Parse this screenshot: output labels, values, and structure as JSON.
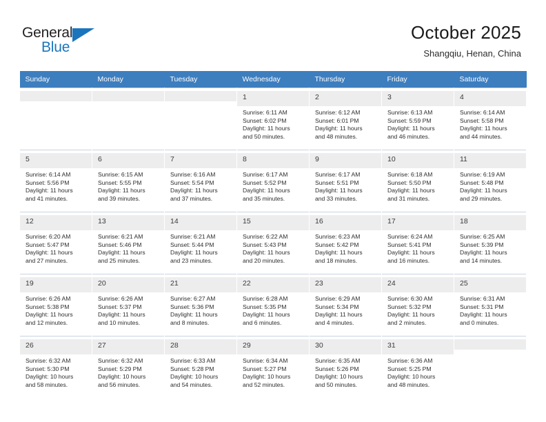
{
  "logo": {
    "word_top": "General",
    "word_bottom": "Blue",
    "triangle_color": "#1b75bc",
    "triangle_icon": "triangle-icon"
  },
  "header": {
    "title": "October 2025",
    "subtitle": "Shangqiu, Henan, China"
  },
  "theme": {
    "header_bg": "#3d7ebf",
    "header_text": "#ffffff",
    "daynum_shade": "#ededed",
    "grid_line": "#c8d4e0",
    "brand_blue": "#1b75bc"
  },
  "weekday_headers": [
    "Sunday",
    "Monday",
    "Tuesday",
    "Wednesday",
    "Thursday",
    "Friday",
    "Saturday"
  ],
  "labels": {
    "sunrise": "Sunrise:",
    "sunset": "Sunset:",
    "daylight": "Daylight:"
  },
  "weeks": [
    [
      {
        "day": "",
        "empty": true,
        "shaded": true,
        "line1": "",
        "line2": "",
        "line3": "",
        "line4": ""
      },
      {
        "day": "",
        "empty": true,
        "shaded": true,
        "line1": "",
        "line2": "",
        "line3": "",
        "line4": ""
      },
      {
        "day": "",
        "empty": true,
        "shaded": true,
        "line1": "",
        "line2": "",
        "line3": "",
        "line4": ""
      },
      {
        "day": "1",
        "empty": false,
        "shaded": true,
        "line1": "Sunrise: 6:11 AM",
        "line2": "Sunset: 6:02 PM",
        "line3": "Daylight: 11 hours",
        "line4": "and 50 minutes."
      },
      {
        "day": "2",
        "empty": false,
        "shaded": true,
        "line1": "Sunrise: 6:12 AM",
        "line2": "Sunset: 6:01 PM",
        "line3": "Daylight: 11 hours",
        "line4": "and 48 minutes."
      },
      {
        "day": "3",
        "empty": false,
        "shaded": true,
        "line1": "Sunrise: 6:13 AM",
        "line2": "Sunset: 5:59 PM",
        "line3": "Daylight: 11 hours",
        "line4": "and 46 minutes."
      },
      {
        "day": "4",
        "empty": false,
        "shaded": true,
        "line1": "Sunrise: 6:14 AM",
        "line2": "Sunset: 5:58 PM",
        "line3": "Daylight: 11 hours",
        "line4": "and 44 minutes."
      }
    ],
    [
      {
        "day": "5",
        "empty": false,
        "shaded": true,
        "line1": "Sunrise: 6:14 AM",
        "line2": "Sunset: 5:56 PM",
        "line3": "Daylight: 11 hours",
        "line4": "and 41 minutes."
      },
      {
        "day": "6",
        "empty": false,
        "shaded": true,
        "line1": "Sunrise: 6:15 AM",
        "line2": "Sunset: 5:55 PM",
        "line3": "Daylight: 11 hours",
        "line4": "and 39 minutes."
      },
      {
        "day": "7",
        "empty": false,
        "shaded": true,
        "line1": "Sunrise: 6:16 AM",
        "line2": "Sunset: 5:54 PM",
        "line3": "Daylight: 11 hours",
        "line4": "and 37 minutes."
      },
      {
        "day": "8",
        "empty": false,
        "shaded": true,
        "line1": "Sunrise: 6:17 AM",
        "line2": "Sunset: 5:52 PM",
        "line3": "Daylight: 11 hours",
        "line4": "and 35 minutes."
      },
      {
        "day": "9",
        "empty": false,
        "shaded": true,
        "line1": "Sunrise: 6:17 AM",
        "line2": "Sunset: 5:51 PM",
        "line3": "Daylight: 11 hours",
        "line4": "and 33 minutes."
      },
      {
        "day": "10",
        "empty": false,
        "shaded": true,
        "line1": "Sunrise: 6:18 AM",
        "line2": "Sunset: 5:50 PM",
        "line3": "Daylight: 11 hours",
        "line4": "and 31 minutes."
      },
      {
        "day": "11",
        "empty": false,
        "shaded": true,
        "line1": "Sunrise: 6:19 AM",
        "line2": "Sunset: 5:48 PM",
        "line3": "Daylight: 11 hours",
        "line4": "and 29 minutes."
      }
    ],
    [
      {
        "day": "12",
        "empty": false,
        "shaded": true,
        "line1": "Sunrise: 6:20 AM",
        "line2": "Sunset: 5:47 PM",
        "line3": "Daylight: 11 hours",
        "line4": "and 27 minutes."
      },
      {
        "day": "13",
        "empty": false,
        "shaded": true,
        "line1": "Sunrise: 6:21 AM",
        "line2": "Sunset: 5:46 PM",
        "line3": "Daylight: 11 hours",
        "line4": "and 25 minutes."
      },
      {
        "day": "14",
        "empty": false,
        "shaded": true,
        "line1": "Sunrise: 6:21 AM",
        "line2": "Sunset: 5:44 PM",
        "line3": "Daylight: 11 hours",
        "line4": "and 23 minutes."
      },
      {
        "day": "15",
        "empty": false,
        "shaded": true,
        "line1": "Sunrise: 6:22 AM",
        "line2": "Sunset: 5:43 PM",
        "line3": "Daylight: 11 hours",
        "line4": "and 20 minutes."
      },
      {
        "day": "16",
        "empty": false,
        "shaded": true,
        "line1": "Sunrise: 6:23 AM",
        "line2": "Sunset: 5:42 PM",
        "line3": "Daylight: 11 hours",
        "line4": "and 18 minutes."
      },
      {
        "day": "17",
        "empty": false,
        "shaded": true,
        "line1": "Sunrise: 6:24 AM",
        "line2": "Sunset: 5:41 PM",
        "line3": "Daylight: 11 hours",
        "line4": "and 16 minutes."
      },
      {
        "day": "18",
        "empty": false,
        "shaded": true,
        "line1": "Sunrise: 6:25 AM",
        "line2": "Sunset: 5:39 PM",
        "line3": "Daylight: 11 hours",
        "line4": "and 14 minutes."
      }
    ],
    [
      {
        "day": "19",
        "empty": false,
        "shaded": true,
        "line1": "Sunrise: 6:26 AM",
        "line2": "Sunset: 5:38 PM",
        "line3": "Daylight: 11 hours",
        "line4": "and 12 minutes."
      },
      {
        "day": "20",
        "empty": false,
        "shaded": true,
        "line1": "Sunrise: 6:26 AM",
        "line2": "Sunset: 5:37 PM",
        "line3": "Daylight: 11 hours",
        "line4": "and 10 minutes."
      },
      {
        "day": "21",
        "empty": false,
        "shaded": true,
        "line1": "Sunrise: 6:27 AM",
        "line2": "Sunset: 5:36 PM",
        "line3": "Daylight: 11 hours",
        "line4": "and 8 minutes."
      },
      {
        "day": "22",
        "empty": false,
        "shaded": true,
        "line1": "Sunrise: 6:28 AM",
        "line2": "Sunset: 5:35 PM",
        "line3": "Daylight: 11 hours",
        "line4": "and 6 minutes."
      },
      {
        "day": "23",
        "empty": false,
        "shaded": true,
        "line1": "Sunrise: 6:29 AM",
        "line2": "Sunset: 5:34 PM",
        "line3": "Daylight: 11 hours",
        "line4": "and 4 minutes."
      },
      {
        "day": "24",
        "empty": false,
        "shaded": true,
        "line1": "Sunrise: 6:30 AM",
        "line2": "Sunset: 5:32 PM",
        "line3": "Daylight: 11 hours",
        "line4": "and 2 minutes."
      },
      {
        "day": "25",
        "empty": false,
        "shaded": true,
        "line1": "Sunrise: 6:31 AM",
        "line2": "Sunset: 5:31 PM",
        "line3": "Daylight: 11 hours",
        "line4": "and 0 minutes."
      }
    ],
    [
      {
        "day": "26",
        "empty": false,
        "shaded": true,
        "line1": "Sunrise: 6:32 AM",
        "line2": "Sunset: 5:30 PM",
        "line3": "Daylight: 10 hours",
        "line4": "and 58 minutes."
      },
      {
        "day": "27",
        "empty": false,
        "shaded": true,
        "line1": "Sunrise: 6:32 AM",
        "line2": "Sunset: 5:29 PM",
        "line3": "Daylight: 10 hours",
        "line4": "and 56 minutes."
      },
      {
        "day": "28",
        "empty": false,
        "shaded": true,
        "line1": "Sunrise: 6:33 AM",
        "line2": "Sunset: 5:28 PM",
        "line3": "Daylight: 10 hours",
        "line4": "and 54 minutes."
      },
      {
        "day": "29",
        "empty": false,
        "shaded": true,
        "line1": "Sunrise: 6:34 AM",
        "line2": "Sunset: 5:27 PM",
        "line3": "Daylight: 10 hours",
        "line4": "and 52 minutes."
      },
      {
        "day": "30",
        "empty": false,
        "shaded": true,
        "line1": "Sunrise: 6:35 AM",
        "line2": "Sunset: 5:26 PM",
        "line3": "Daylight: 10 hours",
        "line4": "and 50 minutes."
      },
      {
        "day": "31",
        "empty": false,
        "shaded": true,
        "line1": "Sunrise: 6:36 AM",
        "line2": "Sunset: 5:25 PM",
        "line3": "Daylight: 10 hours",
        "line4": "and 48 minutes."
      },
      {
        "day": "",
        "empty": true,
        "shaded": true,
        "line1": "",
        "line2": "",
        "line3": "",
        "line4": ""
      }
    ]
  ]
}
